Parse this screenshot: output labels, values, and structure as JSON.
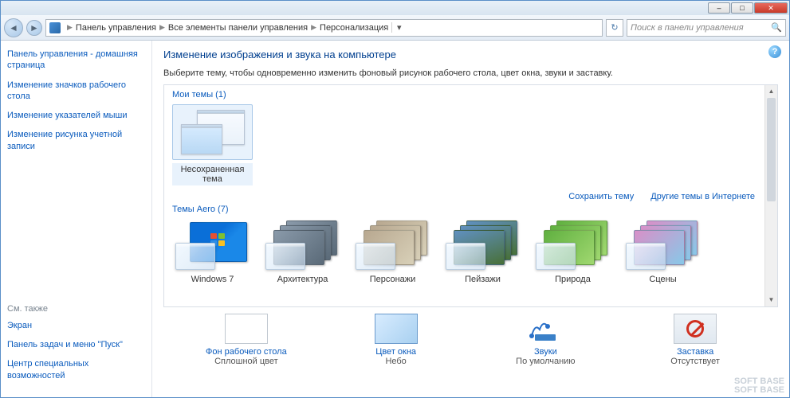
{
  "titlebar": {
    "min": "–",
    "max": "□",
    "close": "✕"
  },
  "nav": {
    "back_glyph": "◄",
    "fwd_glyph": "►",
    "refresh_glyph": "↻",
    "dropdown_glyph": "▾",
    "breadcrumbs": [
      "Панель управления",
      "Все элементы панели управления",
      "Персонализация"
    ],
    "search_placeholder": "Поиск в панели управления"
  },
  "sidebar": {
    "links": [
      "Панель управления - домашняя страница",
      "Изменение значков рабочего стола",
      "Изменение указателей мыши",
      "Изменение рисунка учетной записи"
    ],
    "also_title": "См. также",
    "also_links": [
      "Экран",
      "Панель задач и меню \"Пуск\"",
      "Центр специальных возможностей"
    ]
  },
  "content": {
    "heading": "Изменение изображения и звука на компьютере",
    "description": "Выберите тему, чтобы одновременно изменить фоновый рисунок рабочего стола, цвет окна, звуки и заставку.",
    "my_themes_title": "Мои темы (1)",
    "my_theme_label": "Несохраненная тема",
    "save_theme": "Сохранить тему",
    "other_themes": "Другие темы в Интернете",
    "aero_title": "Темы Aero (7)",
    "aero_themes": [
      "Windows 7",
      "Архитектура",
      "Персонажи",
      "Пейзажи",
      "Природа",
      "Сцены"
    ]
  },
  "options": {
    "bg": {
      "title": "Фон рабочего стола",
      "sub": "Сплошной цвет"
    },
    "color": {
      "title": "Цвет окна",
      "sub": "Небо"
    },
    "sounds": {
      "title": "Звуки",
      "sub": "По умолчанию"
    },
    "saver": {
      "title": "Заставка",
      "sub": "Отсутствует"
    }
  },
  "watermark": "SOFT   BASE"
}
